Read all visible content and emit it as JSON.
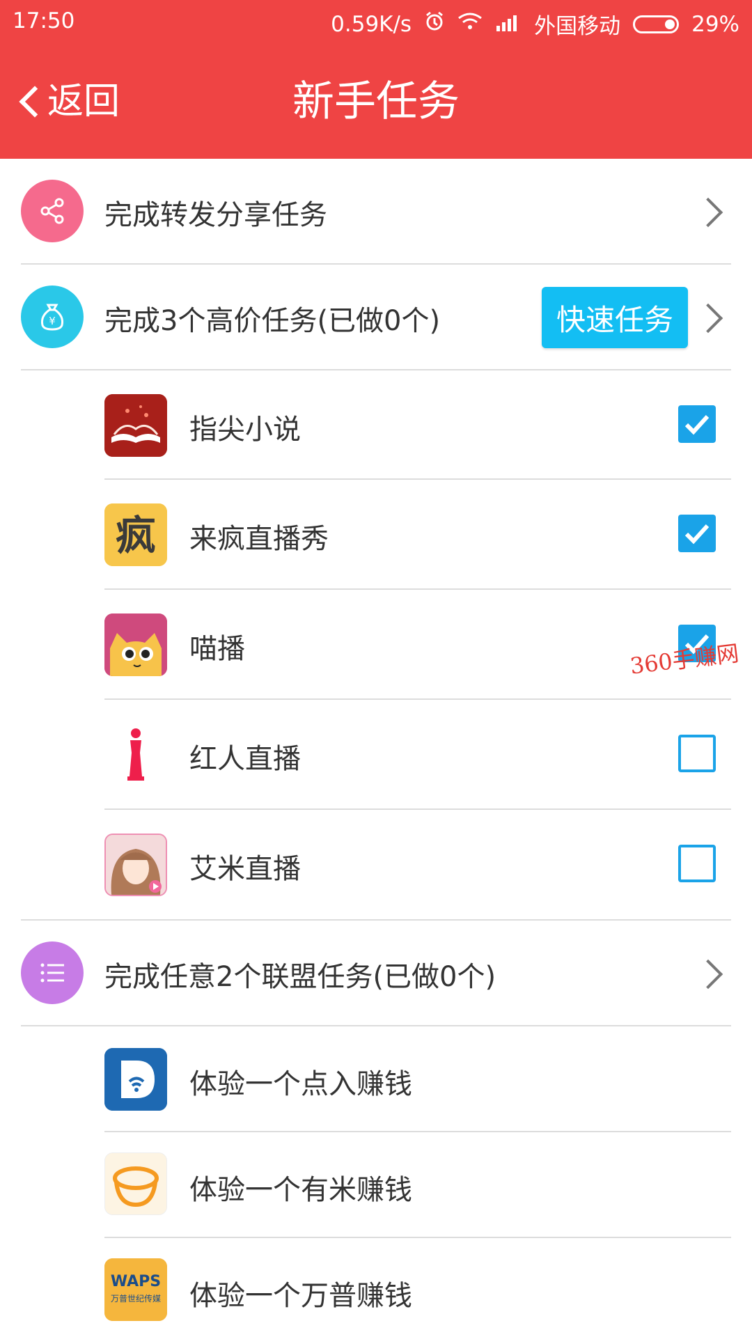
{
  "status_bar": {
    "time": "17:50",
    "speed": "0.59K/s",
    "carrier": "外国移动",
    "battery": "29%"
  },
  "header": {
    "back_label": "返回",
    "title": "新手任务"
  },
  "sections": {
    "share": {
      "title": "完成转发分享任务",
      "icon": "share-icon",
      "color": "#f56a8d"
    },
    "high_price": {
      "title": "完成3个高价任务(已做0个)",
      "icon": "money-bag-icon",
      "color": "#2ac8e8",
      "button": "快速任务"
    },
    "alliance": {
      "title": "完成任意2个联盟任务(已做0个)",
      "icon": "list-icon",
      "color": "#c77ce6"
    }
  },
  "high_price_apps": [
    {
      "name": "指尖小说",
      "checked": true
    },
    {
      "name": "来疯直播秀",
      "checked": true
    },
    {
      "name": "喵播",
      "checked": true
    },
    {
      "name": "红人直播",
      "checked": false
    },
    {
      "name": "艾米直播",
      "checked": false
    }
  ],
  "alliance_apps": [
    {
      "name": "体验一个点入赚钱"
    },
    {
      "name": "体验一个有米赚钱"
    },
    {
      "name": "体验一个万普赚钱"
    }
  ],
  "icon_text": {
    "laifeng": "疯",
    "wanpu_top": "WAPS",
    "wanpu_bottom": "万普世纪传媒"
  },
  "watermark": "360手赚网",
  "colors": {
    "header": "#ef4444",
    "accent": "#1aa3e8",
    "button": "#13bef3"
  }
}
